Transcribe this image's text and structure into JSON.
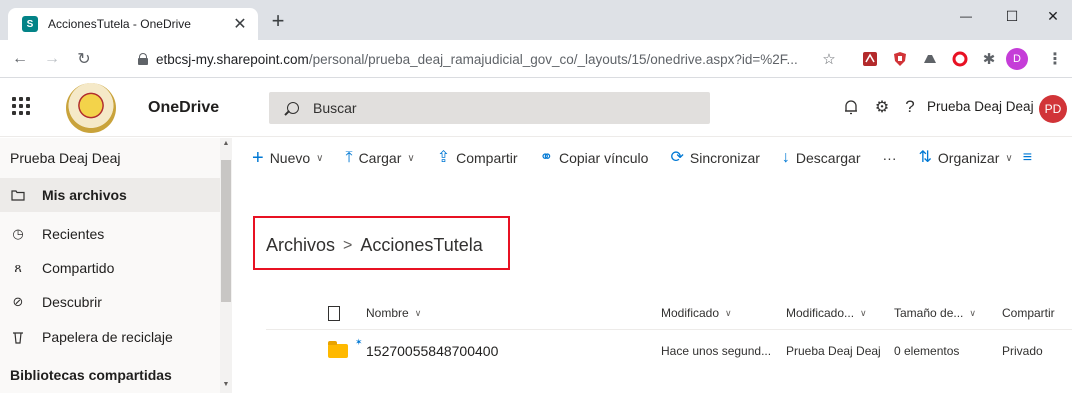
{
  "browser": {
    "tab_title": "AccionesTutela - OneDrive",
    "tab_favicon_letter": "S",
    "tab_close": "✕",
    "new_tab": "+",
    "minimize": "—",
    "maximize": "☐",
    "close": "✕",
    "url_host": "etbcsj-my.sharepoint.com",
    "url_path": "/personal/prueba_deaj_ramajudicial_gov_co/_layouts/15/onedrive.aspx?id=%2F...",
    "profile_letter": "D"
  },
  "header": {
    "app_name": "OneDrive",
    "search_placeholder": "Buscar",
    "user_name": "Prueba Deaj Deaj",
    "avatar_initials": "PD"
  },
  "sidebar": {
    "title": "Prueba Deaj Deaj",
    "items": [
      {
        "label": "Mis archivos",
        "icon": "folder-icon"
      },
      {
        "label": "Recientes",
        "icon": "clock-icon"
      },
      {
        "label": "Compartido",
        "icon": "people-icon"
      },
      {
        "label": "Descubrir",
        "icon": "compass-icon"
      },
      {
        "label": "Papelera de reciclaje",
        "icon": "recycle-bin-icon"
      }
    ],
    "section": "Bibliotecas compartidas"
  },
  "commands": {
    "new": "Nuevo",
    "upload": "Cargar",
    "share": "Compartir",
    "copy_link": "Copiar vínculo",
    "sync": "Sincronizar",
    "download": "Descargar",
    "more": "···",
    "sort": "Organizar"
  },
  "breadcrumb": {
    "root": "Archivos",
    "separator": ">",
    "current": "AccionesTutela"
  },
  "list": {
    "columns": [
      "Nombre",
      "Modificado",
      "Modificado...",
      "Tamaño de...",
      "Compartir"
    ],
    "rows": [
      {
        "name": "15270055848700400",
        "modified": "Hace unos segund...",
        "modified_by": "Prueba Deaj Deaj",
        "size": "0 elementos",
        "sharing": "Privado"
      }
    ]
  },
  "colors": {
    "accent": "#0078d4",
    "highlight_box": "#e81123",
    "avatar": "#d13438"
  }
}
